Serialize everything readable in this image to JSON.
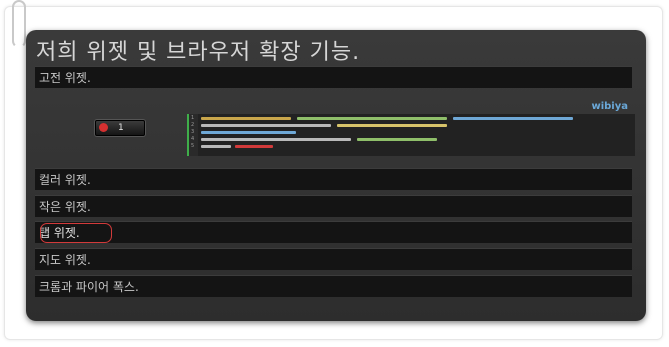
{
  "title": "저희 위젯 및 브라우저 확장 기능.",
  "sections": [
    {
      "label": "고전 위젯."
    },
    {
      "label": "컬러 위젯."
    },
    {
      "label": "작은 위젯."
    },
    {
      "label": "탭 위젯."
    },
    {
      "label": "지도 위젯."
    },
    {
      "label": "크롬과 파이어 폭스."
    }
  ],
  "demo": {
    "counter_value": "1",
    "brand": "wibiya",
    "line_numbers": [
      "1",
      "2",
      "3",
      "4",
      "5"
    ]
  },
  "colors": {
    "panel_bg": "#333333",
    "row_bg": "#141414",
    "highlight_ring": "#d23a3a",
    "code_accent": "#3fae4a",
    "brand": "#6aa8d8"
  }
}
